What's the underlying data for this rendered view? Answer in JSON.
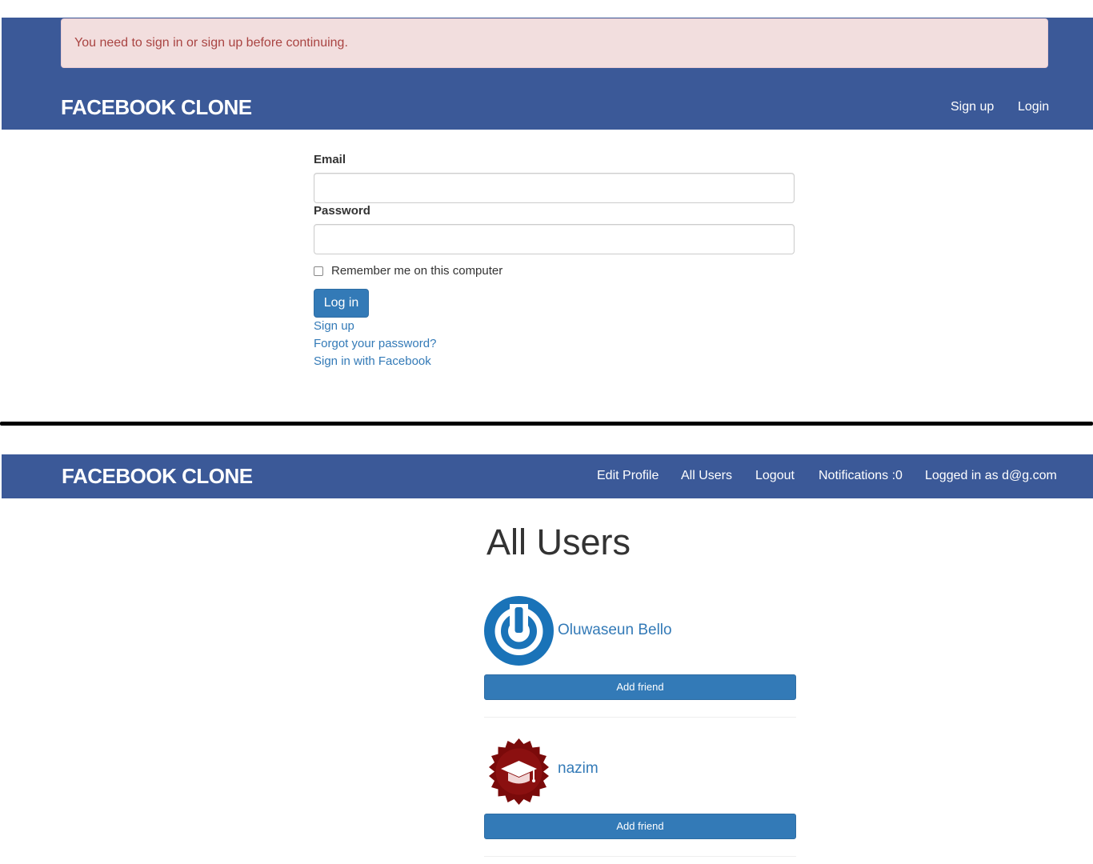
{
  "top": {
    "alert": "You need to sign in or sign up before continuing.",
    "brand": "FACEBOOK CLONE",
    "nav": {
      "signup": "Sign up",
      "login": "Login"
    },
    "form": {
      "email_label": "Email",
      "email_value": "",
      "password_label": "Password",
      "password_value": "",
      "remember_label": "Remember me on this computer",
      "remember_checked": false,
      "submit": "Log in",
      "links": {
        "signup": "Sign up",
        "forgot": "Forgot your password?",
        "facebook": "Sign in with Facebook"
      }
    }
  },
  "bottom": {
    "brand": "FACEBOOK CLONE",
    "nav": {
      "edit_profile": "Edit Profile",
      "all_users": "All Users",
      "logout": "Logout",
      "notifications": "Notifications :0",
      "logged_in": "Logged in as d@g.com"
    },
    "heading": "All Users",
    "users": [
      {
        "name": "Oluwaseun Bello",
        "avatar_icon": "power-logo-icon",
        "button": "Add friend"
      },
      {
        "name": "nazim",
        "avatar_icon": "graduation-cap-seal-icon",
        "button": "Add friend"
      }
    ]
  },
  "colors": {
    "nav_bg": "#3b5998",
    "alert_bg": "#f2dede",
    "alert_text": "#a94442",
    "link": "#337ab7",
    "button": "#337ab7"
  }
}
